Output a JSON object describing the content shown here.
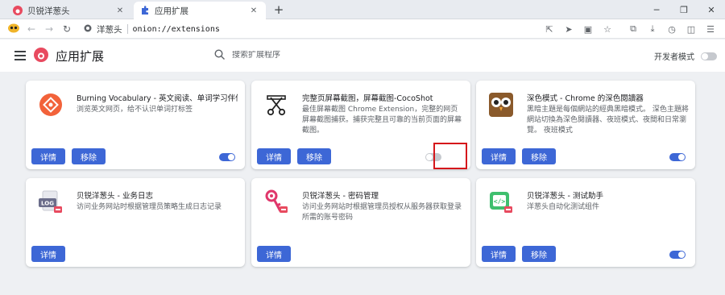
{
  "tabs": [
    {
      "label": "贝锐洋葱头",
      "active": false
    },
    {
      "label": "应用扩展",
      "active": true
    }
  ],
  "window_controls": {
    "minimize": "─",
    "restore": "❐",
    "close": "✕"
  },
  "toolbar": {
    "site_name": "洋葱头",
    "url": "onion://extensions"
  },
  "header": {
    "title": "应用扩展",
    "search_placeholder": "搜索扩展程序",
    "dev_mode_label": "开发者模式",
    "dev_mode_on": false
  },
  "cards": [
    {
      "name": "Burning Vocabulary - 英文阅读、单词学习伴侣",
      "description": "浏览英文网页，给不认识单词打标签",
      "details_label": "详情",
      "remove_label": "移除",
      "enabled": true,
      "icon": "burning-vocabulary-icon"
    },
    {
      "name": "完整页屏幕截图，屏幕截图-CocoShot",
      "description": "最佳屏幕截图 Chrome Extension，完整的网页屏幕截图捕获。捕获完整且可靠的当前页面的屏幕截图。",
      "details_label": "详情",
      "remove_label": "移除",
      "enabled": false,
      "icon": "scissors-icon"
    },
    {
      "name": "深色模式 - Chrome 的深色閱讀器",
      "description": "黑暗主題是每個網站的經典黑暗模式。 深色主題將網站切換為深色閱讀器、夜班模式、夜間和日常瀏覽。 夜班模式",
      "details_label": "详情",
      "remove_label": "移除",
      "enabled": true,
      "icon": "owl-icon"
    },
    {
      "name": "贝锐洋葱头 - 业务日志",
      "description": "访问业务网站时根据管理员策略生成日志记录",
      "details_label": "详情",
      "remove_label": "",
      "enabled": null,
      "icon": "log-icon",
      "icon_text": "LOG"
    },
    {
      "name": "贝锐洋葱头 - 密码管理",
      "description": "访问业务网站时根据管理员授权从服务器获取登录所需的账号密码",
      "details_label": "详情",
      "remove_label": "",
      "enabled": null,
      "icon": "key-icon"
    },
    {
      "name": "贝锐洋葱头 - 测试助手",
      "description": "洋葱头自动化测试组件",
      "details_label": "详情",
      "remove_label": "移除",
      "enabled": true,
      "icon": "code-icon"
    }
  ],
  "colors": {
    "accent": "#3d67d6",
    "highlight": "#d5171b",
    "brand": "#e84a5f"
  }
}
